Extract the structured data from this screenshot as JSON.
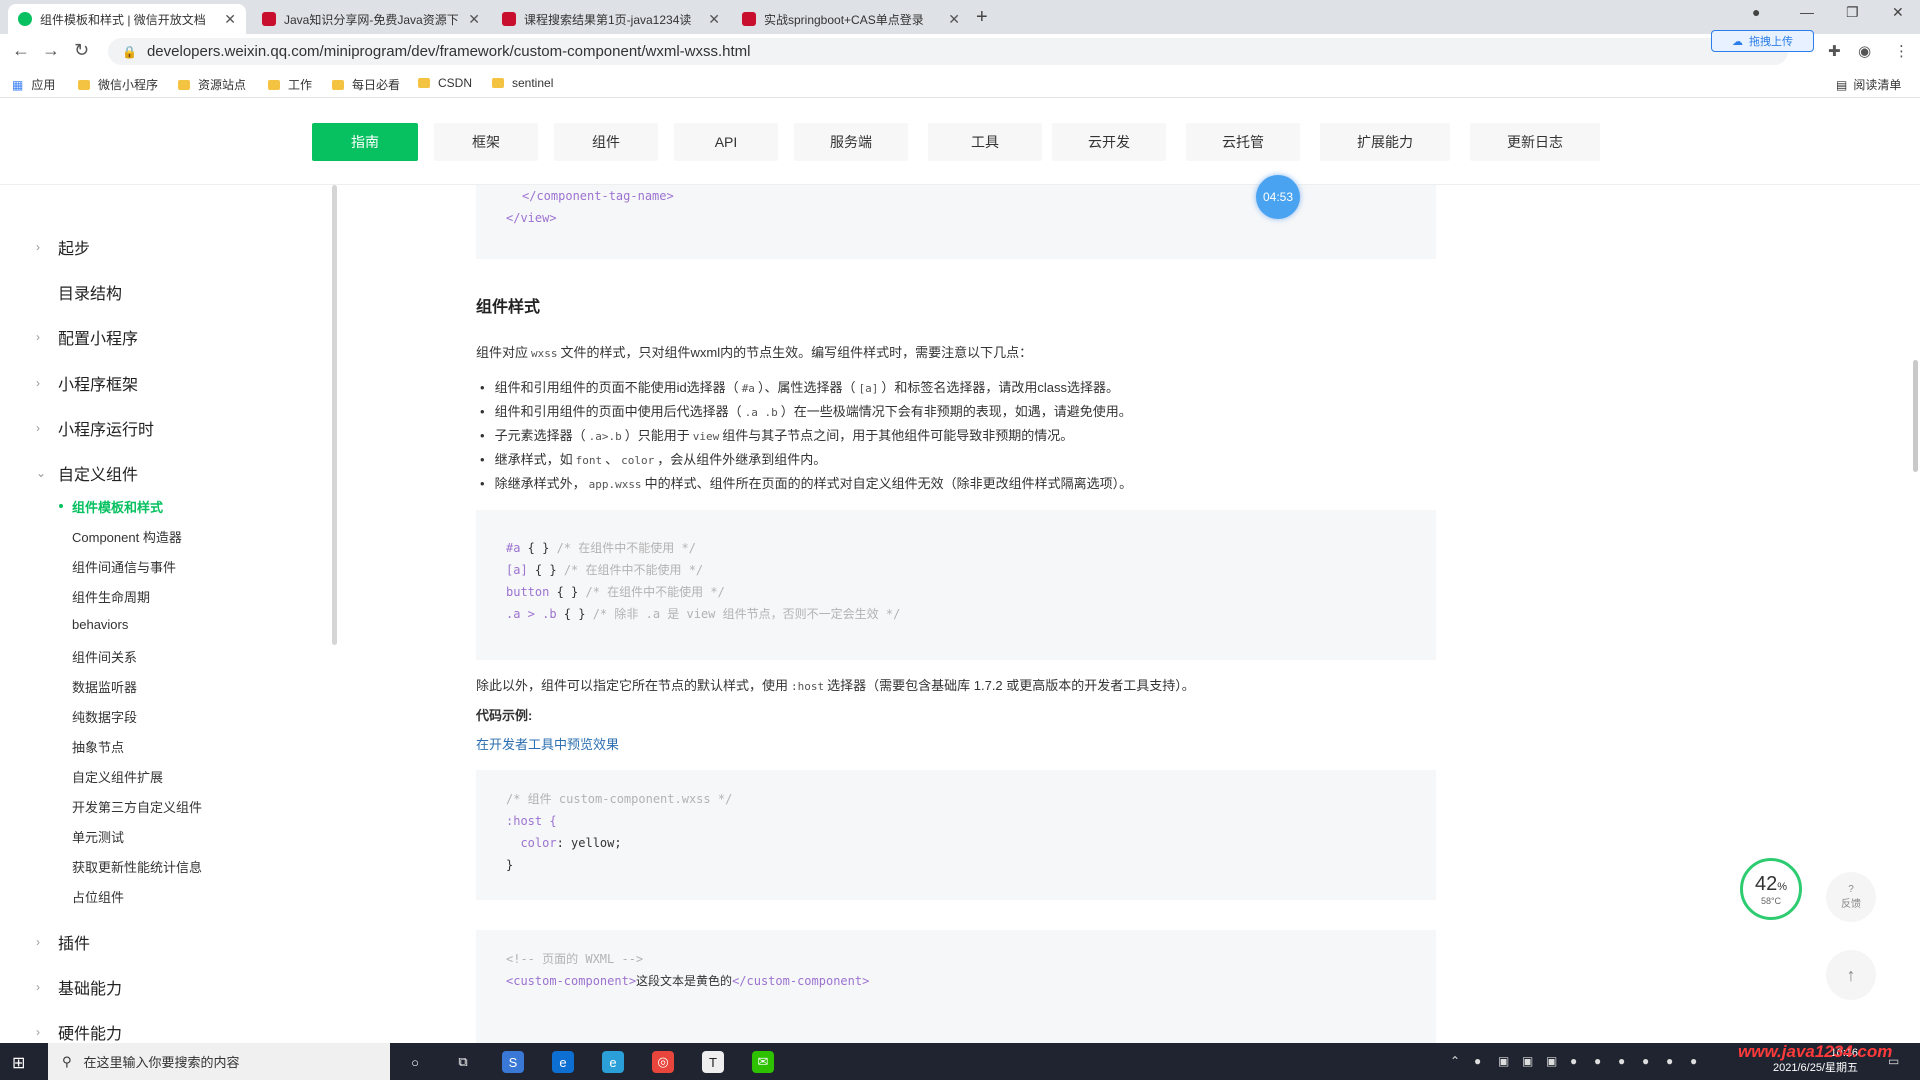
{
  "browser": {
    "tabs": [
      {
        "title": "组件模板和样式 | 微信开放文档",
        "active": true
      },
      {
        "title": "Java知识分享网-免费Java资源下",
        "active": false
      },
      {
        "title": "课程搜索结果第1页-java1234读",
        "active": false
      },
      {
        "title": "实战springboot+CAS单点登录",
        "active": false
      }
    ],
    "new_tab": "+",
    "url": "developers.weixin.qq.com/miniprogram/dev/framework/custom-component/wxml-wxss.html",
    "upload_label": "拖拽上传",
    "bookmarks": [
      "应用",
      "微信小程序",
      "资源站点",
      "工作",
      "每日必看",
      "CSDN",
      "sentinel"
    ],
    "reading_list": "阅读清单"
  },
  "header": {
    "nav": [
      "指南",
      "框架",
      "组件",
      "API",
      "服务端",
      "工具",
      "云开发",
      "云托管",
      "扩展能力",
      "更新日志"
    ],
    "active_nav": "指南"
  },
  "sidebar": {
    "items": [
      {
        "label": "起步",
        "arrow": "›"
      },
      {
        "label": "目录结构",
        "arrow": ""
      },
      {
        "label": "配置小程序",
        "arrow": "›"
      },
      {
        "label": "小程序框架",
        "arrow": "›"
      },
      {
        "label": "小程序运行时",
        "arrow": "›"
      },
      {
        "label": "自定义组件",
        "arrow": "⌄"
      }
    ],
    "sub_items": [
      "组件模板和样式",
      "Component 构造器",
      "组件间通信与事件",
      "组件生命周期",
      "behaviors",
      "组件间关系",
      "数据监听器",
      "纯数据字段",
      "抽象节点",
      "自定义组件扩展",
      "开发第三方自定义组件",
      "单元测试",
      "获取更新性能统计信息",
      "占位组件"
    ],
    "after_items": [
      {
        "label": "插件",
        "arrow": "›"
      },
      {
        "label": "基础能力",
        "arrow": "›"
      },
      {
        "label": "硬件能力",
        "arrow": "›"
      }
    ]
  },
  "content": {
    "code_top": {
      "line1": "</component-tag-name>",
      "line2": "</view>"
    },
    "heading": "组件样式",
    "intro": {
      "pre": "组件对应",
      "code": "wxss",
      "post": "文件的样式，只对组件wxml内的节点生效。编写组件样式时，需要注意以下几点："
    },
    "bullets": [
      {
        "t1": "组件和引用组件的页面不能使用id选择器（",
        "c1": "#a",
        "t2": "）、属性选择器（",
        "c2": "[a]",
        "t3": "）和标签名选择器，请改用class选择器。"
      },
      {
        "t1": "组件和引用组件的页面中使用后代选择器（",
        "c1": ".a .b",
        "t2": "）在一些极端情况下会有非预期的表现，如遇，请避免使用。",
        "c2": "",
        "t3": ""
      },
      {
        "t1": "子元素选择器（",
        "c1": ".a>.b",
        "t2": "）只能用于",
        "c2": "view",
        "t3": "组件与其子节点之间，用于其他组件可能导致非预期的情况。"
      },
      {
        "t1": "继承样式，如",
        "c1": "font",
        "t2": "、",
        "c2": "color",
        "t3": "，会从组件外继承到组件内。"
      },
      {
        "t1": "除继承样式外，",
        "c1": "app.wxss",
        "t2": "中的样式、组件所在页面的的样式对自定义组件无效（除非更改组件样式隔离选项）。",
        "c2": "",
        "t3": ""
      }
    ],
    "code_block_1": [
      {
        "sel": "#a",
        "brace": " { } ",
        "comment": "/* 在组件中不能使用 */"
      },
      {
        "sel": "[a]",
        "brace": " { } ",
        "comment": "/* 在组件中不能使用 */"
      },
      {
        "sel": "button",
        "brace": " { } ",
        "comment": "/* 在组件中不能使用 */"
      },
      {
        "sel": ".a > .b",
        "brace": " { } ",
        "comment": "/* 除非 .a 是 view 组件节点，否则不一定会生效 */"
      }
    ],
    "host_para": {
      "pre": "除此以外，组件可以指定它所在节点的默认样式，使用",
      "code": ":host",
      "post": "选择器（需要包含基础库 1.7.2 或更高版本的开发者工具支持）。"
    },
    "example_label": "代码示例:",
    "preview_link": "在开发者工具中预览效果",
    "code_block_2": {
      "comment": "/* 组件 custom-component.wxss */",
      "selector": ":host {",
      "prop": "color",
      "value": ": yellow;",
      "close": "}"
    },
    "code_block_3": {
      "comment": "<!-- 页面的 WXML -->",
      "open_tag": "<custom-component>",
      "text": "这段文本是黄色的",
      "close_tag": "</custom-component>"
    }
  },
  "widgets": {
    "timer": "04:53",
    "perf_percent": "42",
    "perf_unit": "%",
    "perf_temp": "58°C",
    "feedback_label": "反馈",
    "feedback_icon": "?",
    "back_top": "↑"
  },
  "taskbar": {
    "search_placeholder": "在这里输入你要搜索的内容",
    "time": "10:16",
    "date": "2021/6/25/星期五",
    "watermark": "www.java1234.com"
  },
  "colors": {
    "brand_green": "#07c160",
    "code_purple": "#9c73d1",
    "comment_grey": "#b3b3b3",
    "link_blue": "#2d6fb0"
  }
}
